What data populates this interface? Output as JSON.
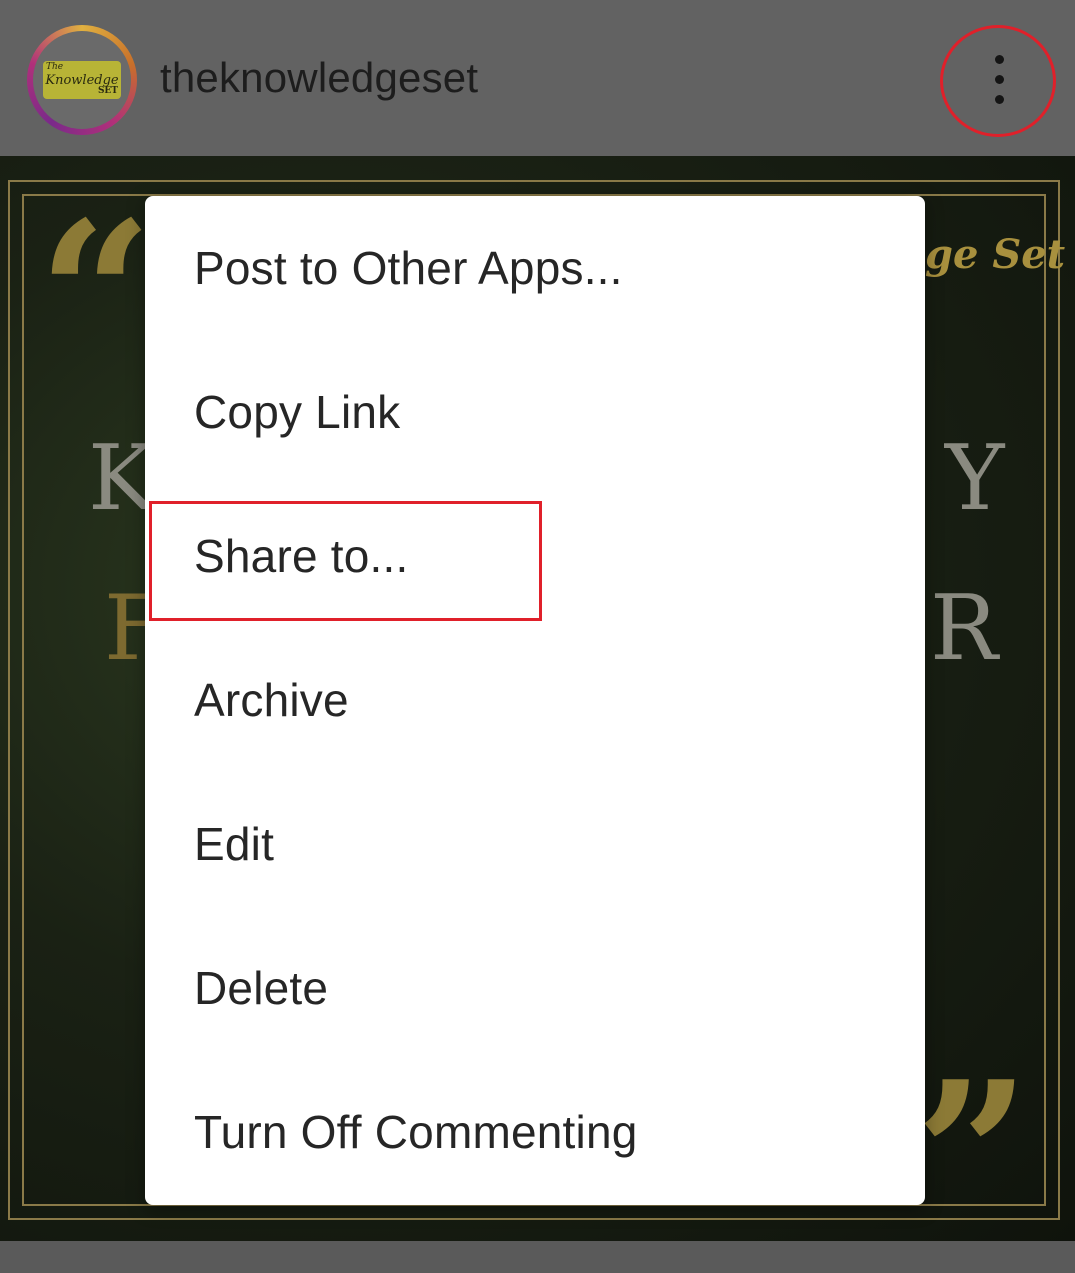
{
  "header": {
    "username": "theknowledgeset",
    "avatar_logo": {
      "top": "The",
      "main": "Knowledge",
      "bottom": "SET"
    },
    "more_icon": "more-vertical-icon",
    "highlight_color": "#e0202a"
  },
  "post": {
    "brand_fragment": "ge Set",
    "letters": [
      "K",
      "Y",
      "F",
      "R"
    ]
  },
  "menu": {
    "items": [
      {
        "label": "Post to Other Apps..."
      },
      {
        "label": "Copy Link"
      },
      {
        "label": "Share to..."
      },
      {
        "label": "Archive"
      },
      {
        "label": "Edit"
      },
      {
        "label": "Delete"
      },
      {
        "label": "Turn Off Commenting"
      }
    ],
    "highlighted_index": 2
  }
}
